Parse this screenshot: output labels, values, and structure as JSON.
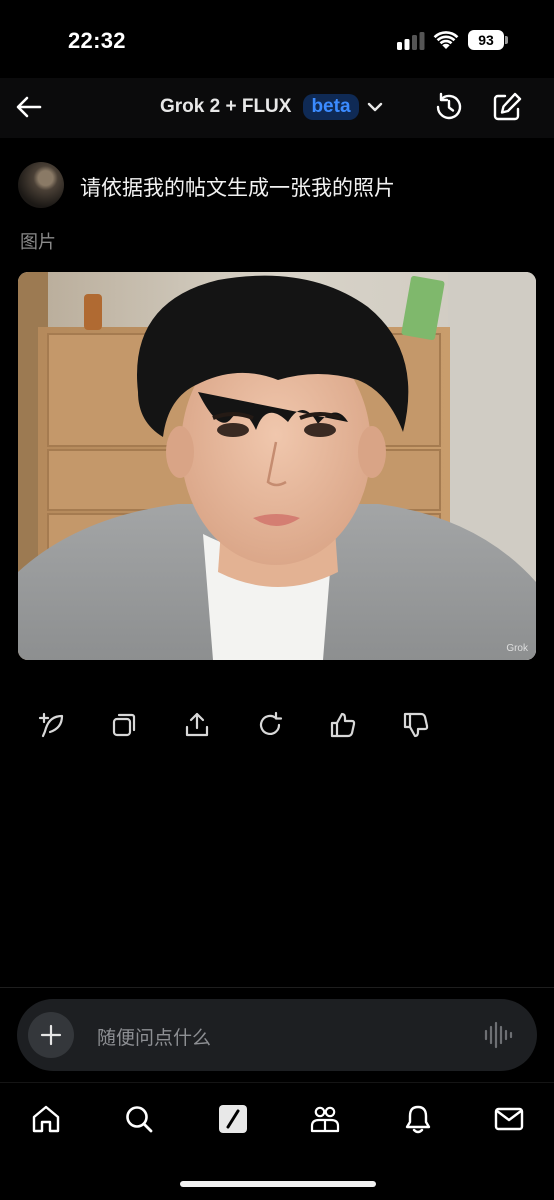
{
  "status_bar": {
    "time": "22:32",
    "battery": "93"
  },
  "header": {
    "title": "Grok 2 + FLUX",
    "badge": "beta"
  },
  "message": {
    "text": "请依据我的帖文生成一张我的照片"
  },
  "image_label": "图片",
  "image": {
    "watermark": "Grok"
  },
  "actions": [
    "regenerate-icon",
    "copy-icon",
    "share-icon",
    "refresh-icon",
    "thumbs-up-icon",
    "thumbs-down-icon"
  ],
  "input": {
    "placeholder": "随便问点什么"
  },
  "tabs": [
    "home-icon",
    "search-icon",
    "grok-icon",
    "communities-icon",
    "notifications-icon",
    "messages-icon"
  ],
  "colors": {
    "background": "#000000",
    "accent": "#3b8bff",
    "badge_bg": "#0f2a55"
  }
}
